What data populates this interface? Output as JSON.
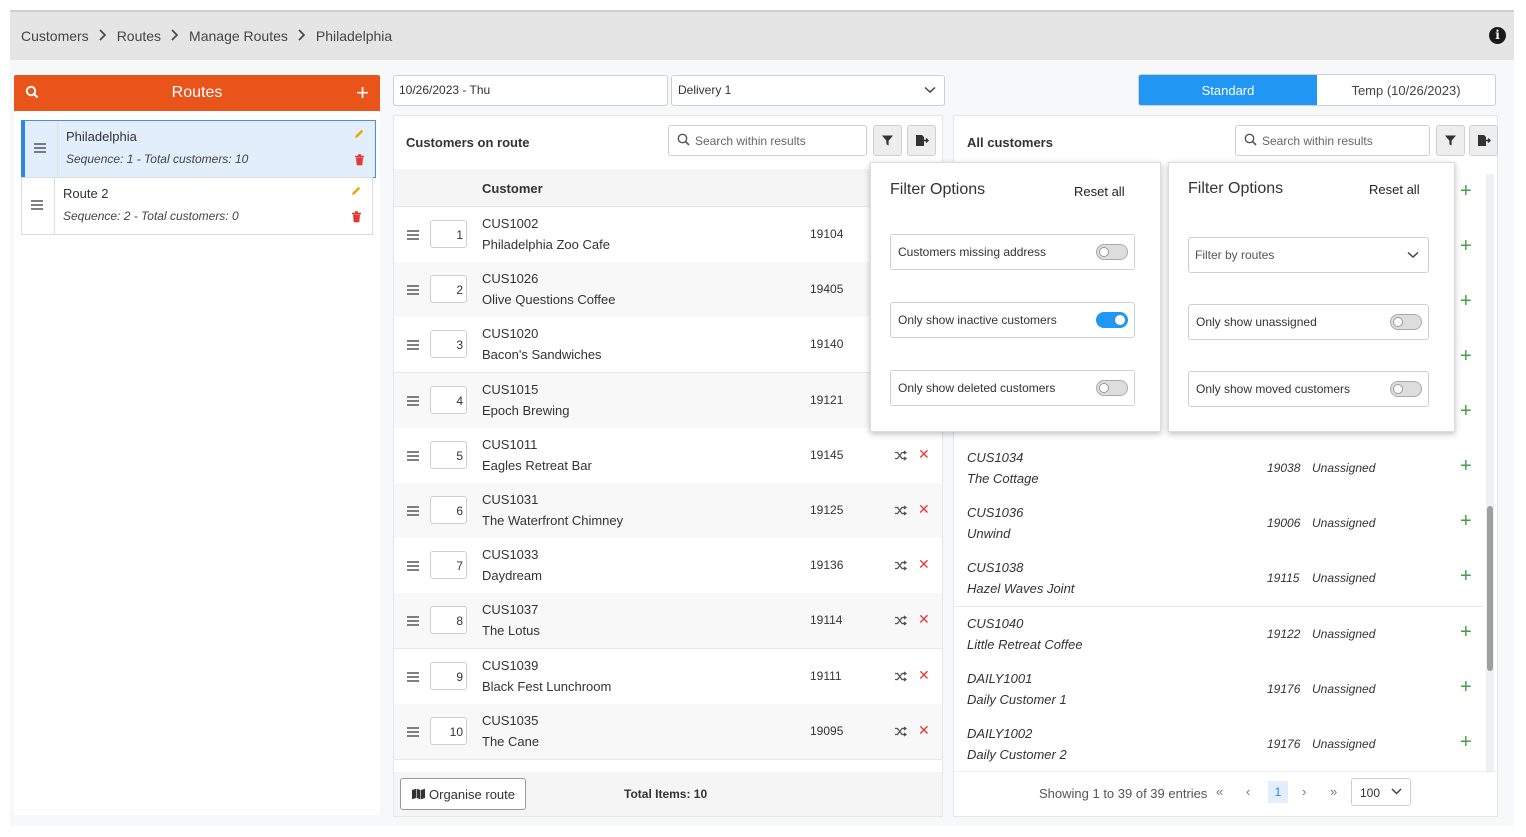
{
  "breadcrumb": {
    "items": [
      "Customers",
      "Routes",
      "Manage Routes",
      "Philadelphia"
    ],
    "info_icon": "info-icon"
  },
  "routes_panel": {
    "title": "Routes",
    "add_icon": "plus-icon",
    "search_icon": "search-icon",
    "items": [
      {
        "name": "Philadelphia",
        "meta": "Sequence: 1 - Total customers: 10",
        "active": true
      },
      {
        "name": "Route 2",
        "meta": "Sequence: 2 - Total customers: 0",
        "active": false
      }
    ]
  },
  "controls": {
    "date": "10/26/2023 - Thu",
    "delivery": "Delivery 1",
    "mode_standard": "Standard",
    "mode_temp": "Temp (10/26/2023)"
  },
  "customers_on_route": {
    "title": "Customers on route",
    "search_placeholder": "Search within results",
    "column_customer": "Customer",
    "rows": [
      {
        "seq": "1",
        "code": "CUS1002",
        "name": "Philadelphia Zoo Cafe",
        "zip": "19104"
      },
      {
        "seq": "2",
        "code": "CUS1026",
        "name": "Olive Questions Coffee",
        "zip": "19405"
      },
      {
        "seq": "3",
        "code": "CUS1020",
        "name": "Bacon's Sandwiches",
        "zip": "19140"
      },
      {
        "seq": "4",
        "code": "CUS1015",
        "name": "Epoch Brewing",
        "zip": "19121"
      },
      {
        "seq": "5",
        "code": "CUS1011",
        "name": "Eagles Retreat Bar",
        "zip": "19145"
      },
      {
        "seq": "6",
        "code": "CUS1031",
        "name": "The Waterfront Chimney",
        "zip": "19125"
      },
      {
        "seq": "7",
        "code": "CUS1033",
        "name": "Daydream",
        "zip": "19136"
      },
      {
        "seq": "8",
        "code": "CUS1037",
        "name": "The Lotus",
        "zip": "19114"
      },
      {
        "seq": "9",
        "code": "CUS1039",
        "name": "Black Fest Lunchroom",
        "zip": "19111"
      },
      {
        "seq": "10",
        "code": "CUS1035",
        "name": "The Cane",
        "zip": "19095"
      }
    ],
    "organise_button": "Organise route",
    "total_items": "Total Items: 10"
  },
  "all_customers": {
    "title": "All customers",
    "search_placeholder": "Search within results",
    "rows": [
      {
        "code": "CUS1034",
        "name": "The Cottage",
        "zip": "19038",
        "status": "Unassigned"
      },
      {
        "code": "CUS1036",
        "name": "Unwind",
        "zip": "19006",
        "status": "Unassigned"
      },
      {
        "code": "CUS1038",
        "name": "Hazel Waves Joint",
        "zip": "19115",
        "status": "Unassigned"
      },
      {
        "code": "CUS1040",
        "name": "Little Retreat Coffee",
        "zip": "19122",
        "status": "Unassigned"
      },
      {
        "code": "DAILY1001",
        "name": "Daily Customer 1",
        "zip": "19176",
        "status": "Unassigned"
      },
      {
        "code": "DAILY1002",
        "name": "Daily Customer 2",
        "zip": "19176",
        "status": "Unassigned"
      }
    ],
    "showing": "Showing 1 to 39 of 39 entries",
    "current_page": "1",
    "page_size": "100"
  },
  "filter_left": {
    "title": "Filter Options",
    "reset": "Reset all",
    "options": [
      {
        "label": "Customers missing address",
        "on": false
      },
      {
        "label": "Only show inactive customers",
        "on": true
      },
      {
        "label": "Only show deleted customers",
        "on": false
      }
    ]
  },
  "filter_right": {
    "title": "Filter Options",
    "reset": "Reset all",
    "select_placeholder": "Filter by routes",
    "options": [
      {
        "label": "Only show unassigned",
        "on": false
      },
      {
        "label": "Only show moved customers",
        "on": false
      }
    ]
  },
  "colors": {
    "routes_header": "#e9541b",
    "primary": "#2196f3",
    "delete": "#e53935",
    "add": "#43a047",
    "edit": "#f0a500"
  }
}
